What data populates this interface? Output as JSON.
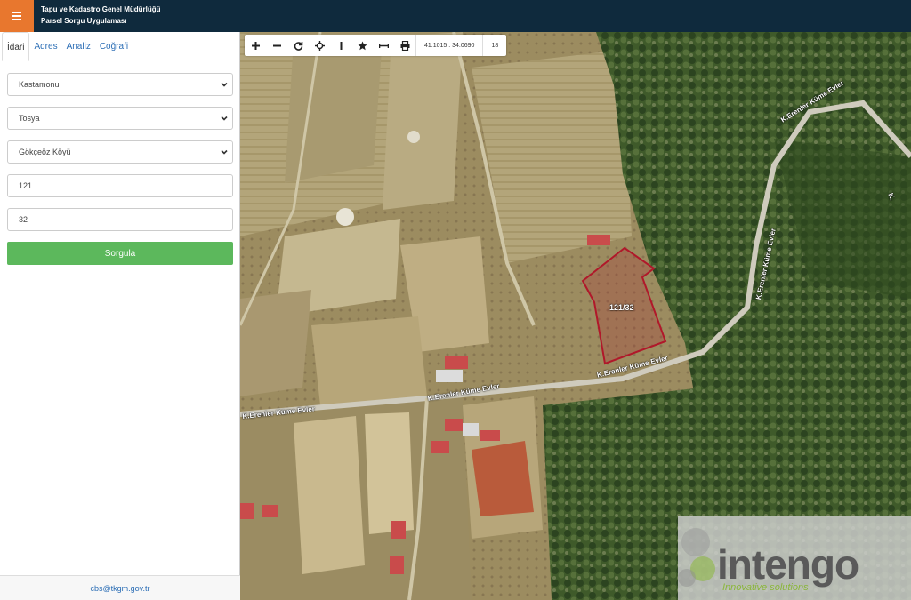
{
  "header": {
    "title_line1": "Tapu ve Kadastro Genel Müdürlüğü",
    "title_line2": "Parsel Sorgu Uygulaması",
    "menu_icon": "hamburger-icon",
    "menu_color": "#e8772e",
    "bar_color": "#0f2a3d"
  },
  "sidebar": {
    "tabs": [
      {
        "label": "İdari",
        "active": true
      },
      {
        "label": "Adres"
      },
      {
        "label": "Analiz"
      },
      {
        "label": "Coğrafi"
      }
    ],
    "province": "Kastamonu",
    "district": "Tosya",
    "neighborhood": "Gökçeöz Köyü",
    "block": "121",
    "parcel": "32",
    "submit_label": "Sorgula",
    "submit_color": "#5cb85c",
    "footer_email": "cbs@tkgm.gov.tr"
  },
  "map": {
    "toolbar": {
      "buttons": [
        "zoom-in-icon",
        "zoom-out-icon",
        "refresh-icon",
        "locate-icon",
        "info-icon",
        "favorite-icon",
        "measure-icon",
        "print-icon"
      ],
      "coordinates": "41.1015 : 34.0690",
      "zoom_level": "18"
    },
    "parcel_label": "121/32",
    "parcel_color": "#b0182a",
    "road_labels": [
      "K.Erenler Küme Evler",
      "K.Erenler Küme Evler",
      "K.Erenler Küme Evler",
      "K.Erenler Küme Evler",
      "K.Erenler Küme Evler"
    ],
    "watermark": {
      "text": "intengo",
      "subtitle": "Innovative solutions"
    }
  }
}
